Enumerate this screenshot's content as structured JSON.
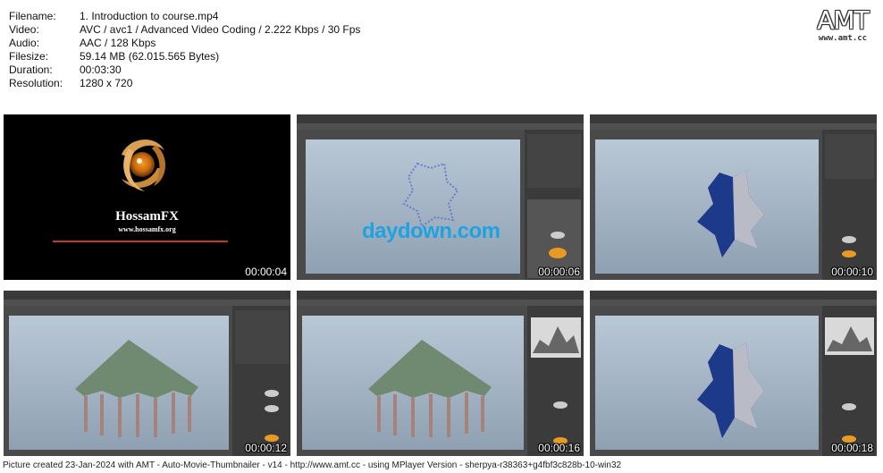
{
  "info": {
    "filename_label": "Filename:",
    "filename": "1. Introduction to course.mp4",
    "video_label": "Video:",
    "video": "AVC / avc1 / Advanced Video Coding / 2.222 Kbps / 30 Fps",
    "audio_label": "Audio:",
    "audio": "AAC / 128 Kbps",
    "filesize_label": "Filesize:",
    "filesize": "59.14 MB (62.015.565 Bytes)",
    "duration_label": "Duration:",
    "duration": "00:03:30",
    "resolution_label": "Resolution:",
    "resolution": "1280 x 720"
  },
  "logo": {
    "big": "AMT",
    "small": "www.amt.cc"
  },
  "intro": {
    "brand": "HossamFX",
    "url": "www.hossamfx.org"
  },
  "watermark": "daydown.com",
  "thumbnails": [
    {
      "timestamp": "00:00:04"
    },
    {
      "timestamp": "00:00:06"
    },
    {
      "timestamp": "00:00:10"
    },
    {
      "timestamp": "00:00:12"
    },
    {
      "timestamp": "00:00:16"
    },
    {
      "timestamp": "00:00:18"
    }
  ],
  "footer": "Picture created 23-Jan-2024 with AMT - Auto-Movie-Thumbnailer - v14 - http://www.amt.cc - using MPlayer Version - sherpya-r38363+g4fbf3c828b-10-win32"
}
